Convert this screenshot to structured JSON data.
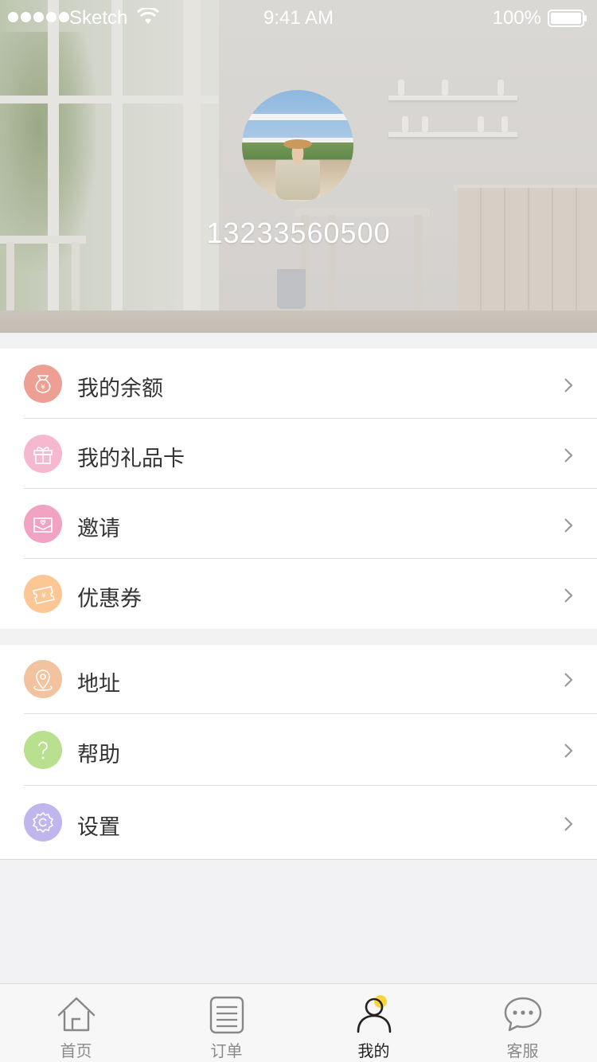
{
  "status_bar": {
    "carrier": "Sketch",
    "time": "9:41 AM",
    "battery": "100%"
  },
  "profile": {
    "phone": "13233560500",
    "avatar": "avatar-photo"
  },
  "menu": {
    "group1": [
      {
        "label": "我的余额",
        "icon": "money-bag-icon",
        "color": "#ee9f94"
      },
      {
        "label": "我的礼品卡",
        "icon": "gift-icon",
        "color": "#f5b8cf"
      },
      {
        "label": "邀请",
        "icon": "invite-envelope-icon",
        "color": "#f0a3c3"
      },
      {
        "label": "优惠券",
        "icon": "coupon-icon",
        "color": "#fcc794"
      }
    ],
    "group2": [
      {
        "label": "地址",
        "icon": "location-pin-icon",
        "color": "#f2c39e"
      },
      {
        "label": "帮助",
        "icon": "help-icon",
        "color": "#b9e08f"
      },
      {
        "label": "设置",
        "icon": "settings-icon",
        "color": "#c1b5ee"
      }
    ]
  },
  "tab_bar": {
    "tabs": [
      {
        "label": "首页",
        "icon": "home-icon"
      },
      {
        "label": "订单",
        "icon": "orders-icon"
      },
      {
        "label": "我的",
        "icon": "profile-icon",
        "active": true
      },
      {
        "label": "客服",
        "icon": "chat-icon"
      }
    ],
    "accent": "#fcd43a"
  }
}
